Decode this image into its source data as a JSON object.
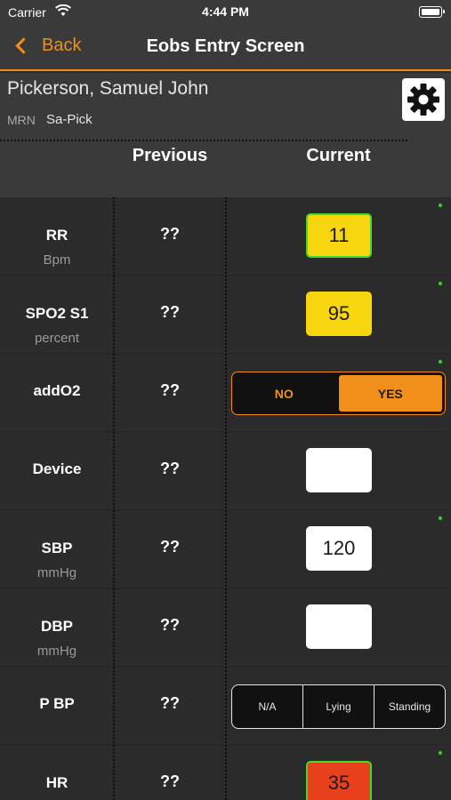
{
  "status_bar": {
    "carrier": "Carrier",
    "time": "4:44 PM"
  },
  "nav": {
    "back_label": "Back",
    "title": "Eobs Entry Screen"
  },
  "patient": {
    "name": "Pickerson, Samuel John",
    "mrn_label": "MRN",
    "mrn_value": "Sa-Pick"
  },
  "columns": {
    "previous": "Previous",
    "current": "Current"
  },
  "colors": {
    "accent": "#f0901a",
    "yellow": "#f7d610",
    "red": "#e8401c",
    "green_dot": "#27d832"
  },
  "rows": [
    {
      "label": "RR",
      "unit": "Bpm",
      "previous": "??",
      "current": "11"
    },
    {
      "label": "SPO2 S1",
      "unit": "percent",
      "previous": "??",
      "current": "95"
    },
    {
      "label": "addO2",
      "unit": "",
      "previous": "??",
      "options": [
        "NO",
        "YES"
      ],
      "selected": "YES"
    },
    {
      "label": "Device",
      "unit": "",
      "previous": "??",
      "current": ""
    },
    {
      "label": "SBP",
      "unit": "mmHg",
      "previous": "??",
      "current": "120"
    },
    {
      "label": "DBP",
      "unit": "mmHg",
      "previous": "??",
      "current": ""
    },
    {
      "label": "P BP",
      "unit": "",
      "previous": "??",
      "options": [
        "N/A",
        "Lying",
        "Standing"
      ]
    },
    {
      "label": "HR",
      "unit": "",
      "previous": "??",
      "current": "35"
    }
  ]
}
